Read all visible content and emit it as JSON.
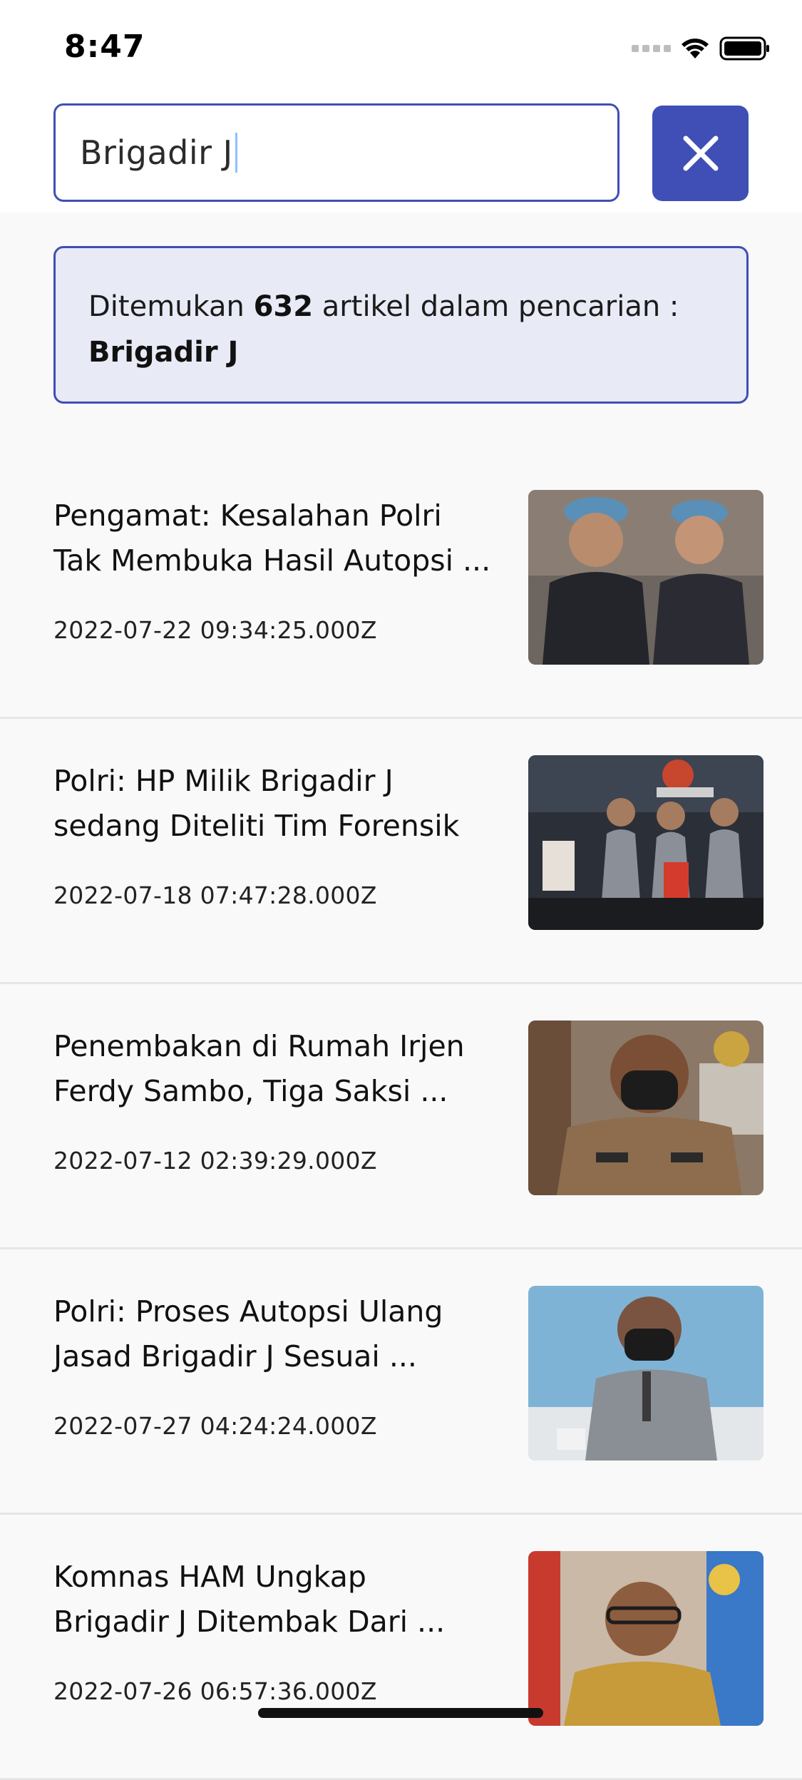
{
  "status_bar": {
    "time": "8:47"
  },
  "search": {
    "query": "Brigadir J"
  },
  "result": {
    "prefix": "Ditemukan",
    "count": "632",
    "middle": "artikel dalam  pencarian :",
    "query": "Brigadir J"
  },
  "articles": [
    {
      "line1": "Pengamat: Kesalahan Polri",
      "line2": "Tak Membuka Hasil Autopsi ...",
      "date": "2022-07-22 09:34:25.000Z"
    },
    {
      "line1": "Polri: HP Milik Brigadir J",
      "line2": "sedang Diteliti Tim Forensik",
      "date": "2022-07-18 07:47:28.000Z"
    },
    {
      "line1": "Penembakan di Rumah Irjen",
      "line2": "Ferdy Sambo, Tiga Saksi ...",
      "date": "2022-07-12 02:39:29.000Z"
    },
    {
      "line1": "Polri: Proses Autopsi Ulang",
      "line2": "Jasad Brigadir J Sesuai ...",
      "date": "2022-07-27 04:24:24.000Z"
    },
    {
      "line1": "Komnas HAM Ungkap",
      "line2": "Brigadir J Ditembak Dari ...",
      "date": "2022-07-26 06:57:36.000Z"
    }
  ],
  "colors": {
    "accent": "#3f4fb5",
    "result_bg": "#e8eaf6",
    "page_bg": "#f9f9f9"
  },
  "icons": [
    "signal-icon",
    "wifi-icon",
    "battery-icon",
    "close-icon"
  ]
}
